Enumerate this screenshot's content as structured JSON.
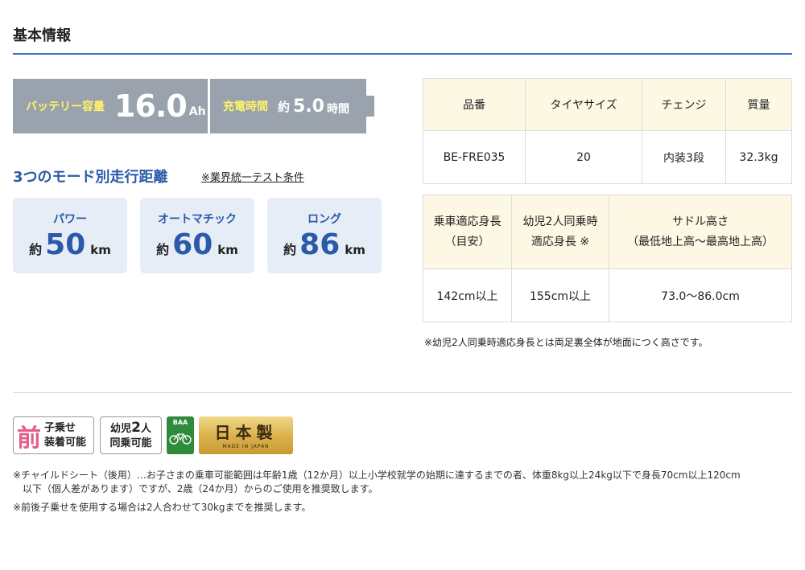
{
  "section_title": "基本情報",
  "battery": {
    "capacity_label": "バッテリー容量",
    "capacity_value": "16.0",
    "capacity_unit": "Ah",
    "charge_label": "充電時間",
    "charge_prefix": "約",
    "charge_value": "5.0",
    "charge_unit": "時間"
  },
  "modes": {
    "title": "3つのモード別走行距離",
    "note": "※業界統一テスト条件",
    "items": [
      {
        "name": "パワー",
        "prefix": "約",
        "value": "50",
        "unit": "km"
      },
      {
        "name": "オートマチック",
        "prefix": "約",
        "value": "60",
        "unit": "km"
      },
      {
        "name": "ロング",
        "prefix": "約",
        "value": "86",
        "unit": "km"
      }
    ]
  },
  "spec_table": {
    "headers": [
      "品番",
      "タイヤサイズ",
      "チェンジ",
      "質量"
    ],
    "row": [
      "BE-FRE035",
      "20",
      "内装3段",
      "32.3kg"
    ]
  },
  "size_table": {
    "headers": [
      {
        "line1": "乗車適応身長",
        "line2": "（目安）"
      },
      {
        "line1": "幼児2人同乗時",
        "line2": "適応身長 ※"
      },
      {
        "line1": "サドル高さ",
        "line2": "（最低地上高〜最高地上高）"
      }
    ],
    "row": [
      "142cm以上",
      "155cm以上",
      "73.0〜86.0cm"
    ]
  },
  "table_note": "※幼児2人同乗時適応身長とは両足裏全体が地面につく高さです。",
  "badges": {
    "front_child_big": "前",
    "front_child_line1": "子乗せ",
    "front_child_line2": "装着可能",
    "infant_line1_a": "幼児",
    "infant_line1_num": "2",
    "infant_line1_b": "人",
    "infant_line2": "同乗可能",
    "baa_label": "BAA",
    "japan_main": "日本製",
    "japan_sub": "MADE IN JAPAN"
  },
  "footnotes": {
    "line1": "※チャイルドシート（後用）…お子さまの乗車可能範囲は年齢1歳（12か月）以上小学校就学の始期に達するまでの者、体重8kg以上24kg以下で身長70cm以上120cm",
    "line1_cont": "以下（個人差があります）ですが、2歳（24か月）からのご使用を推奨致します。",
    "line2": "※前後子乗せを使用する場合は2人合わせて30kgまでを推奨します。"
  },
  "colors": {
    "accent_blue": "#2b5aa8",
    "rule_blue": "#3a6fc4",
    "battery_gray": "#9aa3ad",
    "battery_label_yellow": "#fff36b",
    "card_bg": "#e6edf7",
    "table_header_bg": "#fdf8e3",
    "badge_pink": "#e0608a",
    "baa_green": "#2f8a3c",
    "gold": "#d9b04a"
  }
}
